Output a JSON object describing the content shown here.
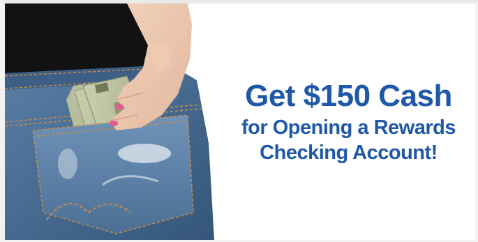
{
  "ad": {
    "headline_line1": "Get $150 Cash",
    "headline_line2": "for Opening a Rewards",
    "headline_line3": "Checking Account!",
    "text_color": "#1f58a8",
    "background_color": "#ffffff",
    "photo_subject": "hand-placing-cash-in-jeans-back-pocket"
  }
}
